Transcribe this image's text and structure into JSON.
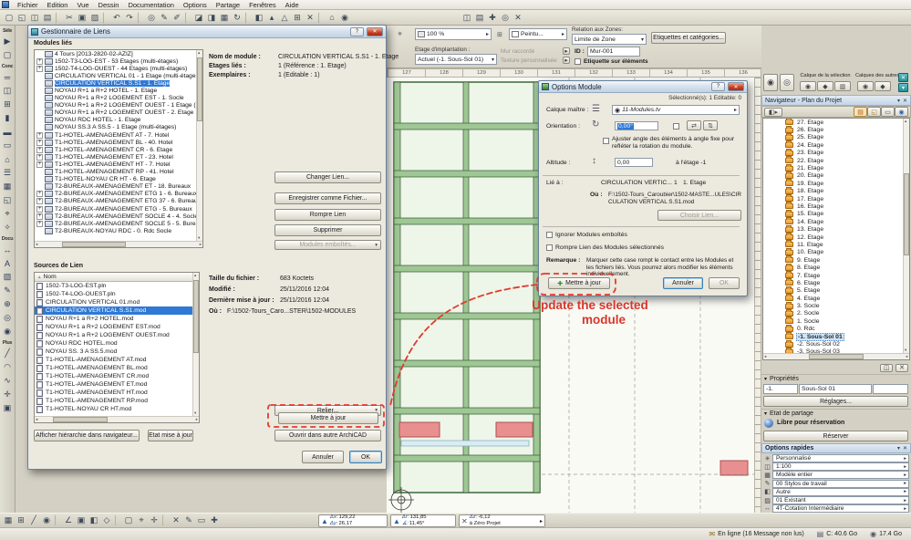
{
  "menu": {
    "items": [
      "Fichier",
      "Edition",
      "Vue",
      "Dessin",
      "Documentation",
      "Options",
      "Partage",
      "Fenêtres",
      "Aide"
    ]
  },
  "top_toolbar": {
    "icons": [
      {
        "n": "new-document",
        "g": "▢"
      },
      {
        "n": "open-file",
        "g": "◱"
      },
      {
        "n": "save",
        "g": "◫"
      },
      {
        "n": "print",
        "g": "▤"
      },
      {
        "sep": true
      },
      {
        "n": "cut",
        "g": "✂"
      },
      {
        "n": "copy",
        "g": "▣"
      },
      {
        "n": "paste",
        "g": "▨"
      },
      {
        "sep": true
      },
      {
        "n": "undo",
        "g": "↶"
      },
      {
        "n": "redo",
        "g": "↷"
      },
      {
        "sep": true
      },
      {
        "n": "find-select",
        "g": "◎"
      },
      {
        "n": "pen",
        "g": "✎"
      },
      {
        "n": "marker",
        "g": "✐"
      },
      {
        "sep": true
      },
      {
        "n": "wall-favorites",
        "g": "◪"
      },
      {
        "n": "door-favorites",
        "g": "◨"
      },
      {
        "n": "grid-snap",
        "g": "▦"
      },
      {
        "n": "rotate-view",
        "g": "↻"
      },
      {
        "sep": true
      },
      {
        "n": "layers",
        "g": "◧"
      },
      {
        "n": "story-up",
        "g": "▴"
      },
      {
        "n": "scale",
        "g": "△"
      },
      {
        "n": "schedule",
        "g": "⊞"
      },
      {
        "n": "close-view",
        "g": "✕"
      },
      {
        "sep": true
      },
      {
        "n": "home-3d",
        "g": "⌂"
      },
      {
        "n": "camera",
        "g": "◉"
      },
      {
        "sp": true
      },
      {
        "n": "teamwork",
        "g": "◫"
      },
      {
        "n": "publish",
        "g": "▤"
      },
      {
        "n": "add-view",
        "g": "✚"
      },
      {
        "n": "preview",
        "g": "◎"
      },
      {
        "n": "quit-view",
        "g": "✕"
      }
    ]
  },
  "toolbox": {
    "items": [
      {
        "n": "selection-section-label",
        "g": "Séle",
        "lab": true
      },
      {
        "n": "arrow-tool",
        "g": "▶"
      },
      {
        "n": "marquee-tool",
        "g": "▢"
      },
      {
        "n": "design-section-label",
        "g": "Conc",
        "lab": true
      },
      {
        "n": "wall-tool",
        "g": "═"
      },
      {
        "n": "door-tool",
        "g": "◫"
      },
      {
        "n": "window-tool",
        "g": "⊞"
      },
      {
        "n": "column-tool",
        "g": "▮"
      },
      {
        "n": "beam-tool",
        "g": "▬"
      },
      {
        "n": "slab-tool",
        "g": "▭"
      },
      {
        "n": "roof-tool",
        "g": "⌂"
      },
      {
        "n": "stair-tool",
        "g": "☰"
      },
      {
        "n": "mesh-tool",
        "g": "▦"
      },
      {
        "n": "zone-tool",
        "g": "◱"
      },
      {
        "n": "object-tool",
        "g": "⌖"
      },
      {
        "n": "lamp-tool",
        "g": "✧"
      },
      {
        "n": "documentation-section-label",
        "g": "Docu",
        "lab": true
      },
      {
        "n": "dimension-tool",
        "g": "↔"
      },
      {
        "n": "text-tool",
        "g": "A"
      },
      {
        "n": "fill-tool",
        "g": "▨"
      },
      {
        "n": "label-tool",
        "g": "✎"
      },
      {
        "n": "section-tool",
        "g": "⊕"
      },
      {
        "n": "elevation-tool",
        "g": "◎"
      },
      {
        "n": "camera-tool",
        "g": "◉"
      },
      {
        "n": "more-section-label",
        "g": "Plus",
        "lab": true
      },
      {
        "n": "line-tool",
        "g": "╱"
      },
      {
        "n": "arc-tool",
        "g": "◠"
      },
      {
        "n": "spline-tool",
        "g": "∿"
      },
      {
        "n": "hotspot-tool",
        "g": "✛"
      },
      {
        "n": "figure-tool",
        "g": "▣"
      }
    ]
  },
  "infobox": {
    "zoom_value": "100 %",
    "paint_value": "Peintu...",
    "relation_label": "Relation aux Zones:",
    "relation_value": "Limite de Zone",
    "tags_button": "Etiquettes et catégories...",
    "floor_label": "Etage d'implantation :",
    "floor_value": "Actuel (-1. Sous-Sol 01)",
    "wall_connected": "Mur raccordé",
    "custom_texture": "Texture personnalisée",
    "id_label": "ID :",
    "id_value": "Mur-001",
    "label_on_elements": "Etiquette sur éléments"
  },
  "ruler": {
    "numbers": [
      "127",
      "128",
      "129",
      "130",
      "131",
      "132",
      "133",
      "134",
      "135",
      "136"
    ]
  },
  "link_manager": {
    "title": "Gestionnaire de Liens",
    "modules_label": "Modules liés",
    "tree": [
      {
        "label": "4 Tours  [2013-2820-02-AZIZ]",
        "root": true
      },
      {
        "label": "1502-T3-LOG-EST - 53 Etages (multi-étages)",
        "plus": true
      },
      {
        "label": "1502-T4-LOG-OUEST - 44 Etages (multi-étages)",
        "plus": true
      },
      {
        "label": "CIRCULATION VERTICAL 01 - 1 Etage (multi-étages)"
      },
      {
        "label": "CIRCULATION VERTICAL S.S1 - 1. Etage",
        "selected": true
      },
      {
        "label": "NOYAU R+1 a R+2 HOTEL - 1. Etage"
      },
      {
        "label": "NOYAU R+1 a R+2 LOGEMENT EST - 1. Socle"
      },
      {
        "label": "NOYAU R+1 a R+2 LOGEMENT OUEST - 1 Etage (multi-étag"
      },
      {
        "label": "NOYAU R+1 a R+2 LOGEMENT OUEST - 2. Etage"
      },
      {
        "label": "NOYAU RDC HOTEL - 1. Etage"
      },
      {
        "label": "NOYAU SS.3 A SS.5 - 1 Etage (multi-étages)"
      },
      {
        "label": "T1-HOTEL-AMENAGEMENT AT - 7. Hotel",
        "plus": true
      },
      {
        "label": "T1-HOTEL-AMENAGEMENT BL - 40. Hotel",
        "plus": true
      },
      {
        "label": "T1-HOTEL-AMENAGEMENT CR - 6. Etage",
        "plus": true
      },
      {
        "label": "T1-HOTEL-AMENAGEMENT ET - 23. Hotel",
        "plus": true
      },
      {
        "label": "T1-HOTEL-AMENAGEMENT HT - 7. Hotel",
        "plus": true
      },
      {
        "label": "T1-HOTEL-AMENAGEMENT RP - 41. Hotel"
      },
      {
        "label": "T1-HOTEL-NOYAU CR HT - 6. Etage"
      },
      {
        "label": "T2-BUREAUX-AMENAGEMENT ET - 18. Bureaux"
      },
      {
        "label": "T2-BUREAUX-AMENAGEMENT ETG 1 - 6. Bureaux",
        "plus": true
      },
      {
        "label": "T2-BUREAUX-AMENAGEMENT ETG 37 - 6. Bureaux",
        "plus": true
      },
      {
        "label": "T2-BUREAUX-AMENAGEMENT ETG - 5. Bureaux",
        "plus": true
      },
      {
        "label": "T2-BUREAUX-AMENAGEMENT SOCLE 4 - 4. Socle",
        "plus": true
      },
      {
        "label": "T2-BUREAUX-AMENAGEMENT SOCLE 5 - 5. Bureaux",
        "plus": true
      },
      {
        "label": "T2-BUREAUX-NOYAU RDC - 0. Rdc Socle"
      }
    ],
    "info": {
      "name_label": "Nom de module :",
      "name_value": "CIRCULATION VERTICAL S.S1 - 1. Etage",
      "stories_label": "Etages liés :",
      "stories_value": "1 (Référence : 1. Etage)",
      "instances_label": "Exemplaires :",
      "instances_value": "1 (Editable : 1)"
    },
    "buttons": {
      "change": "Changer Lien...",
      "save_as": "Enregistrer comme Fichier...",
      "break_link": "Rompre Lien",
      "delete": "Supprimer",
      "nested": "Modules emboîtés..."
    },
    "sources_label": "Sources de Lien",
    "sources_col": "Nom",
    "sources": [
      {
        "label": "1502-T3-LOG-EST.pln"
      },
      {
        "label": "1502-T4-LOG-OUEST.pln"
      },
      {
        "label": "CIRCULATION VERTICAL 01.mod"
      },
      {
        "label": "CIRCULATION VERTICAL S.S1.mod",
        "selected": true
      },
      {
        "label": "NOYAU R+1 a R+2 HOTEL.mod"
      },
      {
        "label": "NOYAU R+1 a R+2 LOGEMENT EST.mod"
      },
      {
        "label": "NOYAU R+1 a R+2 LOGEMENT OUEST.mod"
      },
      {
        "label": "NOYAU RDC HOTEL.mod"
      },
      {
        "label": "NOYAU SS. 3 A SS.5.mod"
      },
      {
        "label": "T1-HOTEL-AMENAGEMENT AT.mod"
      },
      {
        "label": "T1-HOTEL-AMENAGEMENT BL.mod"
      },
      {
        "label": "T1-HOTEL-AMENAGEMENT CR.mod"
      },
      {
        "label": "T1-HOTEL-AMENAGEMENT ET.mod"
      },
      {
        "label": "T1-HOTEL-AMENAGEMENT HT.mod"
      },
      {
        "label": "T1-HOTEL-AMENAGEMENT RP.mod"
      },
      {
        "label": "T1-HOTEL-NOYAU CR HT.mod"
      }
    ],
    "file_info": {
      "size_label": "Taille du fichier :",
      "size_value": "683 Koctets",
      "modified_label": "Modifié :",
      "modified_value": "25/11/2016 12:04",
      "updated_label": "Dernière mise à jour :",
      "updated_value": "25/11/2016 12:04",
      "where_label": "Où :",
      "where_value": "F:\\1502-Tours_Caro...STER\\1502-MODULES"
    },
    "actions": {
      "relink": "Relier...",
      "update": "Mettre à jour",
      "open_other": "Ouvrir dans autre ArchiCAD"
    },
    "footer": {
      "hierarchy": "Afficher hiérarchie dans navigateur...",
      "update_status": "Etat mise à jour",
      "cancel": "Annuler",
      "ok": "OK"
    }
  },
  "module_options": {
    "title": "Options Module",
    "selection_info": "Sélectionné(s): 1 Editable: 0",
    "master_layer_label": "Calque maître :",
    "master_layer_value": "11-Modules.tv",
    "orientation_label": "Orientation :",
    "orientation_value": "0,00°",
    "adjust_angle_text": "Ajuster angle des éléments à angle fixe pour refléter la rotation du module.",
    "elevation_label": "Altitude :",
    "elevation_value": "0,00",
    "elevation_story": "à l'étage -1",
    "linked_label": "Lié à :",
    "linked_value": "CIRCULATION VERTIC...",
    "linked_count": "1",
    "linked_story": "1. Etage",
    "where_label": "Où :",
    "where_value": "F:\\1502-Tours_Caroubier\\1502-MASTE...ULES\\CIRCULATION VERTICAL S.S1.mod",
    "choose_link": "Choisir Lien...",
    "skip_nested": "Ignorer Modules emboîtés",
    "break_link": "Rompre Lien des Modules sélectionnés",
    "note_label": "Remarque :",
    "note_text": "Marquer cette case rompt le contact entre les Modules et les fichiers liés. Vous pourrez alors modifier les éléments individuellement.",
    "update": "Mettre à jour",
    "cancel": "Annuler",
    "ok": "OK"
  },
  "annotation": {
    "line1": "Update the selected",
    "line2": "module",
    "color": "#d8372b"
  },
  "layers_bar": {
    "selection_label": "Calque de la sélection",
    "others_label": "Calques des autres"
  },
  "navigator": {
    "title": "Navigateur - Plan du Projet",
    "floors": [
      {
        "label": "27. Etage"
      },
      {
        "label": "26. Etage"
      },
      {
        "label": "25. Etage"
      },
      {
        "label": "24. Etage"
      },
      {
        "label": "23. Etage"
      },
      {
        "label": "22. Etage"
      },
      {
        "label": "21. Etage"
      },
      {
        "label": "20. Etage"
      },
      {
        "label": "19. Etage"
      },
      {
        "label": "18. Etage"
      },
      {
        "label": "17. Etage"
      },
      {
        "label": "16. Etage"
      },
      {
        "label": "15. Etage"
      },
      {
        "label": "14. Etage"
      },
      {
        "label": "13. Etage"
      },
      {
        "label": "12. Etage"
      },
      {
        "label": "11. Etage"
      },
      {
        "label": "10. Etage"
      },
      {
        "label": "9. Etage"
      },
      {
        "label": "8. Etage"
      },
      {
        "label": "7. Etage"
      },
      {
        "label": "6. Etage"
      },
      {
        "label": "5. Etage"
      },
      {
        "label": "4. Etage"
      },
      {
        "label": "3. Socle"
      },
      {
        "label": "2. Socle"
      },
      {
        "label": "1. Socle"
      },
      {
        "label": "0. Rdc"
      },
      {
        "label": "-1. Sous-Sol 01",
        "selected": true
      },
      {
        "label": "-2. Sous-Sol 02"
      },
      {
        "label": "-3. Sous-Sol 03"
      }
    ]
  },
  "properties": {
    "header": "Propriétés",
    "story_number": "-1.",
    "story_name": "Sous-Sol 01",
    "settings_button": "Réglages..."
  },
  "sharing": {
    "header": "Etat de partage",
    "status": "Libre pour réservation",
    "reserve_button": "Réserver"
  },
  "quick_options": {
    "header": "Options rapides",
    "rows": [
      {
        "icon": "✳",
        "label": "Personnalisé"
      },
      {
        "icon": "◫",
        "label": "1:100"
      },
      {
        "icon": "▦",
        "label": "Modèle entier"
      },
      {
        "icon": "✎",
        "label": "00 Stylos de travail"
      },
      {
        "icon": "◧",
        "label": "Autre"
      },
      {
        "icon": "▨",
        "label": "01 Existant"
      },
      {
        "icon": "↔",
        "label": "4T-Cotation Intermédiaire"
      }
    ]
  },
  "bottom_toolbar": {
    "icons": [
      {
        "n": "grid-display",
        "g": "▦"
      },
      {
        "n": "snap-grid",
        "g": "⊞"
      },
      {
        "n": "guide-lines",
        "g": "╱"
      },
      {
        "n": "magnet-snap",
        "g": "◉"
      },
      {
        "sep": true
      },
      {
        "n": "ortho-angle",
        "g": "∠"
      },
      {
        "n": "group-toggle",
        "g": "▣"
      },
      {
        "n": "layer-quick",
        "g": "◧"
      },
      {
        "n": "suspend-groups",
        "g": "◇"
      },
      {
        "sep": true
      },
      {
        "n": "marquee-restrict",
        "g": "▢"
      },
      {
        "n": "gravity",
        "g": "⌖"
      },
      {
        "n": "element-snap",
        "g": "✛"
      },
      {
        "sep": true
      },
      {
        "n": "cancel-input",
        "g": "✕"
      },
      {
        "n": "tracer-reference",
        "g": "✎"
      },
      {
        "n": "grid-rotate",
        "g": "▭"
      },
      {
        "n": "add-coordinate",
        "g": "✚"
      }
    ]
  },
  "tracker": {
    "dx_label": "Δx:",
    "dx": "129,22",
    "dy_label": "Δy:",
    "dy": "26,17",
    "dr_label": "Δr:",
    "dr": "131,85",
    "angle_label": "∡:",
    "angle": "11,45°",
    "dz_label": "Δz:",
    "dz": "-6,12",
    "origin": "à Zéro Projet"
  },
  "status_bar": {
    "online": "En ligne (16 Message non lus)",
    "disk_c": "C: 40.6 Go",
    "disk_free": "17.4 Go"
  }
}
